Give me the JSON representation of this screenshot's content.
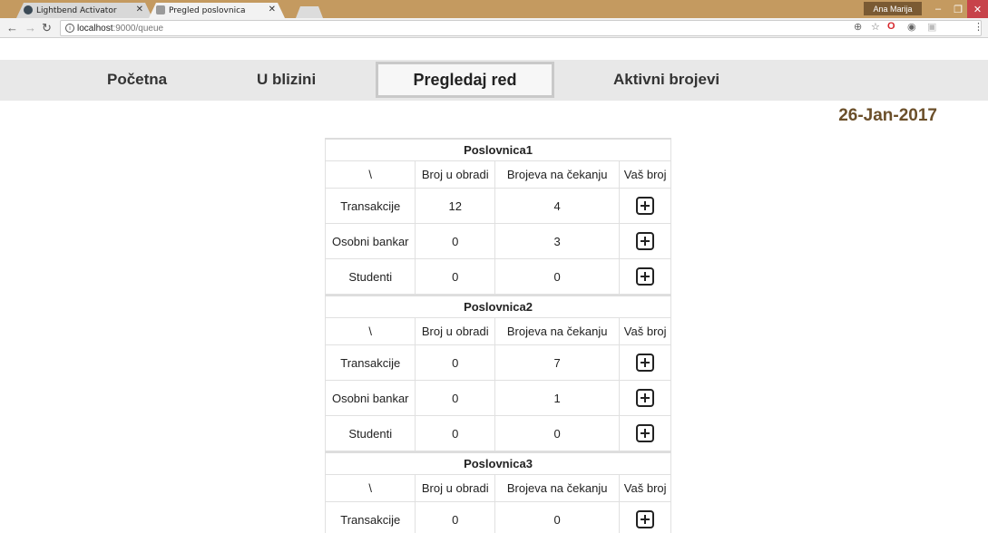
{
  "browser": {
    "tabs": [
      {
        "title": "Lightbend Activator"
      },
      {
        "title": "Pregled poslovnica"
      }
    ],
    "user": "Ana Marija",
    "url_host": "localhost",
    "url_path": ":9000/queue"
  },
  "nav": {
    "home": "Početna",
    "nearby": "U blizini",
    "queue": "Pregledaj red",
    "active": "Aktivni brojevi"
  },
  "date": "26-Jan-2017",
  "headers": [
    "\\",
    "Broj u obradi",
    "Brojeva na čekanju",
    "Vaš broj"
  ],
  "branches": [
    {
      "name": "Poslovnica1",
      "rows": [
        {
          "service": "Transakcije",
          "processing": "12",
          "waiting": "4"
        },
        {
          "service": "Osobni bankar",
          "processing": "0",
          "waiting": "3"
        },
        {
          "service": "Studenti",
          "processing": "0",
          "waiting": "0"
        }
      ]
    },
    {
      "name": "Poslovnica2",
      "rows": [
        {
          "service": "Transakcije",
          "processing": "0",
          "waiting": "7"
        },
        {
          "service": "Osobni bankar",
          "processing": "0",
          "waiting": "1"
        },
        {
          "service": "Studenti",
          "processing": "0",
          "waiting": "0"
        }
      ]
    },
    {
      "name": "Poslovnica3",
      "rows": [
        {
          "service": "Transakcije",
          "processing": "0",
          "waiting": "0"
        }
      ]
    }
  ]
}
